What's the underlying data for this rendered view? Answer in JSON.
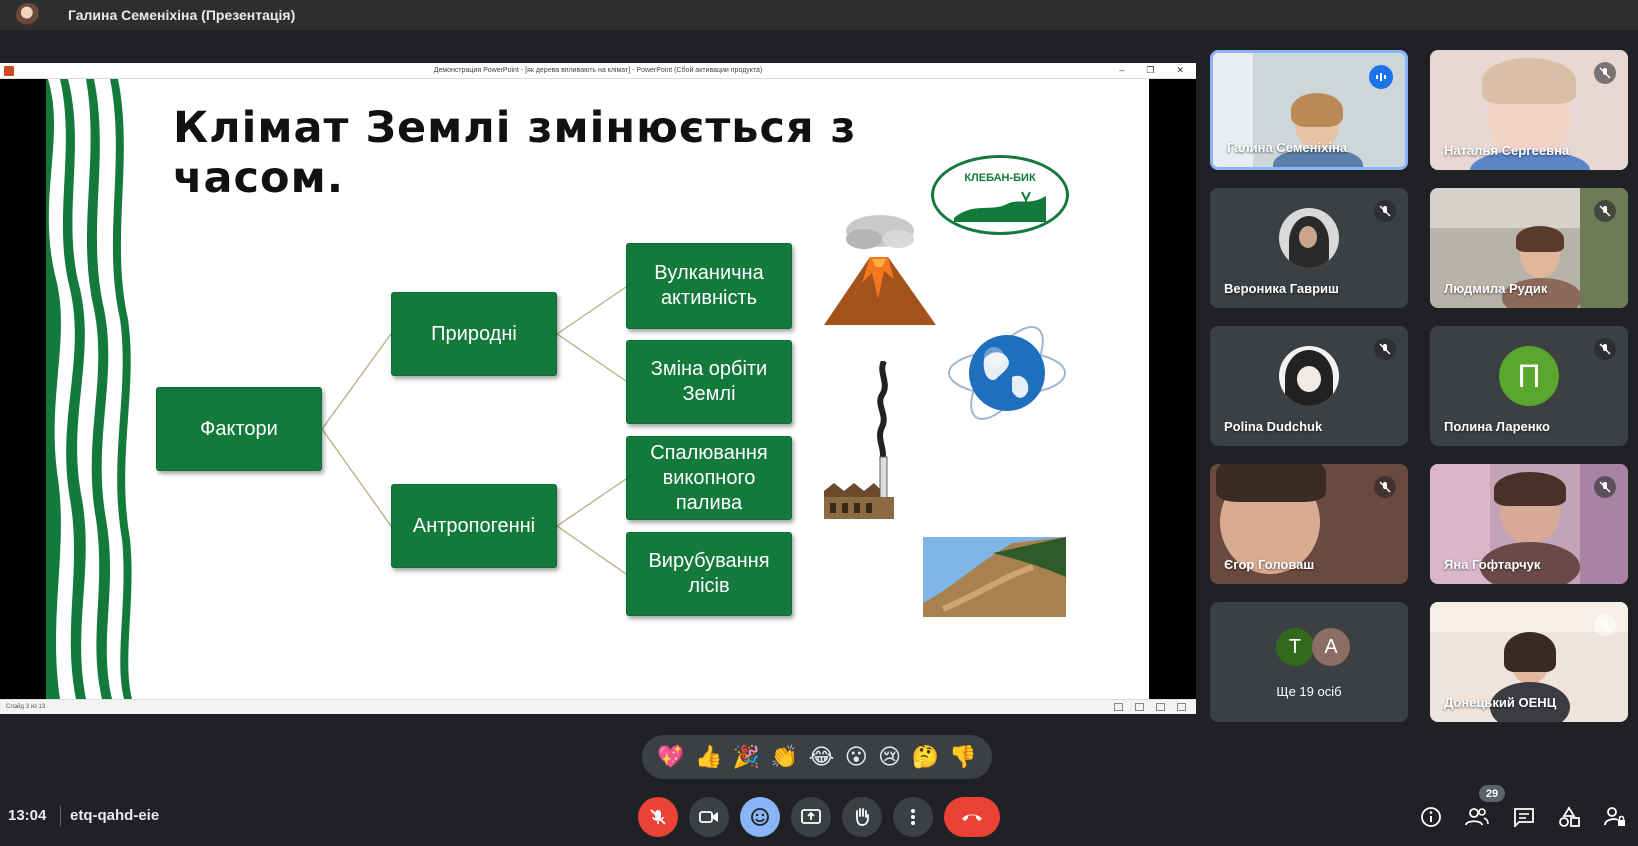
{
  "topbar": {
    "presenter_title": "Галина Семеніхіна (Презентація)"
  },
  "ppt": {
    "window_title": "Демонстрация PowerPoint - [як дерева впливають на клімат] - PowerPoint (Сбой активации продукта)",
    "controls": [
      "–",
      "❐",
      "✕"
    ],
    "status": "Слайд 3 из 13"
  },
  "slide": {
    "title_line1": "Клімат Землі змінюється з",
    "title_line2": "часом.",
    "logo_text": "КЛЕБАН-БИК",
    "boxes": {
      "factors": "Фактори",
      "natural": "Природні",
      "anthropogenic": "Антропогенні",
      "volcanic_1": "Вулканична",
      "volcanic_2": "активність",
      "orbit_1": "Зміна орбіти",
      "orbit_2": "Землі",
      "fuel_1": "Спалювання",
      "fuel_2": "викопного",
      "fuel_3": "палива",
      "forest_1": "Вирубування",
      "forest_2": "лісів"
    },
    "colors": {
      "box": "#137a3c",
      "accent": "#137a3c"
    }
  },
  "participants": [
    {
      "name": "Галина Семеніхіна",
      "state": "speaking"
    },
    {
      "name": "Наталья Сергеевна",
      "state": "muted"
    },
    {
      "name": "Вероника Гавриш",
      "state": "muted"
    },
    {
      "name": "Людмила Рудик",
      "state": "muted"
    },
    {
      "name": "Polina Dudchuk",
      "state": "muted"
    },
    {
      "name": "Полина Ларенко",
      "state": "muted",
      "initial": "П"
    },
    {
      "name": "Єгор Головаш",
      "state": "muted"
    },
    {
      "name": "Яна Гофтарчук",
      "state": "muted"
    },
    {
      "name": "Донецький ОЕНЦ",
      "state": "muted"
    }
  ],
  "others": {
    "initials": [
      "Т",
      "А"
    ],
    "label": "Ще 19 осіб"
  },
  "reactions": [
    "💖",
    "👍",
    "🎉",
    "👏",
    "😂",
    "😮",
    "😢",
    "🤔",
    "👎"
  ],
  "bottombar": {
    "time": "13:04",
    "meeting_code": "etq-qahd-eie",
    "people_count": "29",
    "controls": [
      "mic-off",
      "camera",
      "emoji",
      "present",
      "raise-hand",
      "more",
      "end-call"
    ],
    "right_controls": [
      "info",
      "people",
      "chat",
      "activities",
      "host-controls"
    ]
  }
}
